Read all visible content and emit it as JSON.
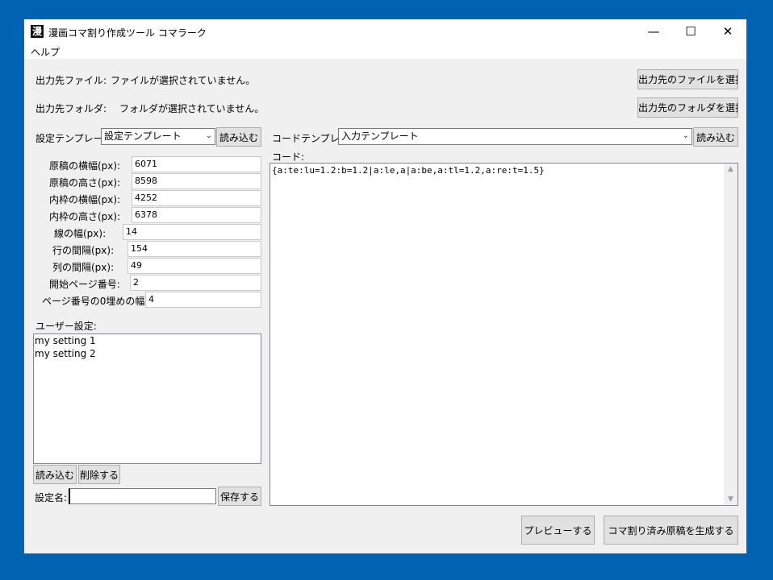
{
  "window": {
    "app_icon": "漫",
    "title": "漫画コマ割り作成ツール コマラーク",
    "minimize": "—",
    "maximize": "☐",
    "close": "✕"
  },
  "menu": {
    "help": "ヘルプ"
  },
  "output": {
    "file_label": "出力先ファイル:",
    "file_value": "ファイルが選択されていません。",
    "file_button": "出力先のファイルを選択",
    "folder_label": "出力先フォルダ:",
    "folder_value": "フォルダが選択されていません。",
    "folder_button": "出力先のフォルダを選択"
  },
  "settings_template": {
    "label": "設定テンプレート:",
    "selected": "設定テンプレート",
    "load_button": "読み込む"
  },
  "fields": [
    {
      "label": "原稿の横幅(px):",
      "value": "6071"
    },
    {
      "label": "原稿の高さ(px):",
      "value": "8598"
    },
    {
      "label": "内枠の横幅(px):",
      "value": "4252"
    },
    {
      "label": "内枠の高さ(px):",
      "value": "6378"
    },
    {
      "label": "線の幅(px):",
      "value": "14"
    },
    {
      "label": "行の間隔(px):",
      "value": "154"
    },
    {
      "label": "列の間隔(px):",
      "value": "49"
    },
    {
      "label": "開始ページ番号:",
      "value": "2"
    },
    {
      "label": "ページ番号の0埋めの幅:",
      "value": "4"
    }
  ],
  "user_settings": {
    "label": "ユーザー設定:",
    "items": [
      "my setting 1",
      "my setting 2"
    ],
    "load_button": "読み込む",
    "delete_button": "削除する",
    "name_label": "設定名:",
    "name_value": "",
    "save_button": "保存する"
  },
  "code_template": {
    "label": "コードテンプレート:",
    "selected": "入力テンプレート",
    "load_button": "読み込む"
  },
  "code": {
    "label": "コード:",
    "value": "{a:te:lu=1.2:b=1.2|a:le,a|a:be,a:tl=1.2,a:re:t=1.5}"
  },
  "actions": {
    "preview": "プレビューする",
    "generate": "コマ割り済み原稿を生成する"
  }
}
